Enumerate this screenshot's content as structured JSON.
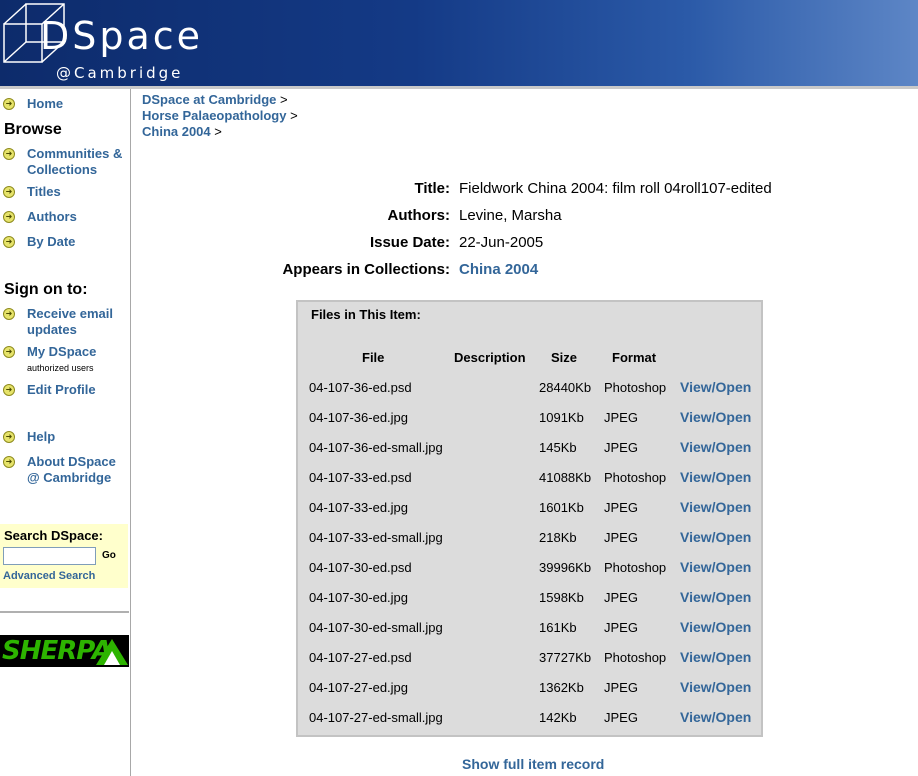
{
  "header": {
    "logo_main": "DSpace",
    "logo_sub": "@Cambridge"
  },
  "sidebar": {
    "items_top": [
      {
        "label": "Home"
      }
    ],
    "browse_heading": "Browse",
    "browse_items": [
      {
        "label": "Communities & Collections"
      },
      {
        "label": "Titles"
      },
      {
        "label": "Authors"
      },
      {
        "label": "By Date"
      }
    ],
    "sign_on_heading": "Sign on to:",
    "sign_on_items": [
      {
        "label": "Receive email updates",
        "sub": ""
      },
      {
        "label": "My DSpace",
        "sub": "authorized users"
      },
      {
        "label": "Edit Profile",
        "sub": ""
      }
    ],
    "help_items": [
      {
        "label": "Help"
      },
      {
        "label": "About DSpace @ Cambridge"
      }
    ],
    "search": {
      "title": "Search DSpace:",
      "go_label": "Go",
      "advanced_label": "Advanced Search",
      "value": ""
    },
    "sherpa_label": "SHERPA"
  },
  "breadcrumbs": [
    {
      "label": "DSpace at Cambridge",
      "sep": ">"
    },
    {
      "label": "Horse Palaeopathology",
      "sep": ">"
    },
    {
      "label": "China 2004",
      "sep": ">"
    }
  ],
  "item": {
    "title_label": "Title:",
    "title_value": "Fieldwork China 2004: film roll 04roll107-edited",
    "authors_label": "Authors:",
    "authors_value": "Levine, Marsha",
    "issue_date_label": "Issue Date:",
    "issue_date_value": "22-Jun-2005",
    "collections_label": "Appears in Collections:",
    "collections_value": "China 2004"
  },
  "files": {
    "title": "Files in This Item:",
    "headers": {
      "file": "File",
      "description": "Description",
      "size": "Size",
      "format": "Format"
    },
    "rows": [
      {
        "file": "04-107-36-ed.psd",
        "size": "28440Kb",
        "format": "Photoshop",
        "action": "View/Open"
      },
      {
        "file": "04-107-36-ed.jpg",
        "size": "1091Kb",
        "format": "JPEG",
        "action": "View/Open"
      },
      {
        "file": "04-107-36-ed-small.jpg",
        "size": "145Kb",
        "format": "JPEG",
        "action": "View/Open"
      },
      {
        "file": "04-107-33-ed.psd",
        "size": "41088Kb",
        "format": "Photoshop",
        "action": "View/Open"
      },
      {
        "file": "04-107-33-ed.jpg",
        "size": "1601Kb",
        "format": "JPEG",
        "action": "View/Open"
      },
      {
        "file": "04-107-33-ed-small.jpg",
        "size": "218Kb",
        "format": "JPEG",
        "action": "View/Open"
      },
      {
        "file": "04-107-30-ed.psd",
        "size": "39996Kb",
        "format": "Photoshop",
        "action": "View/Open"
      },
      {
        "file": "04-107-30-ed.jpg",
        "size": "1598Kb",
        "format": "JPEG",
        "action": "View/Open"
      },
      {
        "file": "04-107-30-ed-small.jpg",
        "size": "161Kb",
        "format": "JPEG",
        "action": "View/Open"
      },
      {
        "file": "04-107-27-ed.psd",
        "size": "37727Kb",
        "format": "Photoshop",
        "action": "View/Open"
      },
      {
        "file": "04-107-27-ed.jpg",
        "size": "1362Kb",
        "format": "JPEG",
        "action": "View/Open"
      },
      {
        "file": "04-107-27-ed-small.jpg",
        "size": "142Kb",
        "format": "JPEG",
        "action": "View/Open"
      }
    ]
  },
  "show_full_label": "Show full item record",
  "colors": {
    "link": "#336699",
    "search_bg": "#ffffcc",
    "files_bg": "#dcdcdc"
  }
}
